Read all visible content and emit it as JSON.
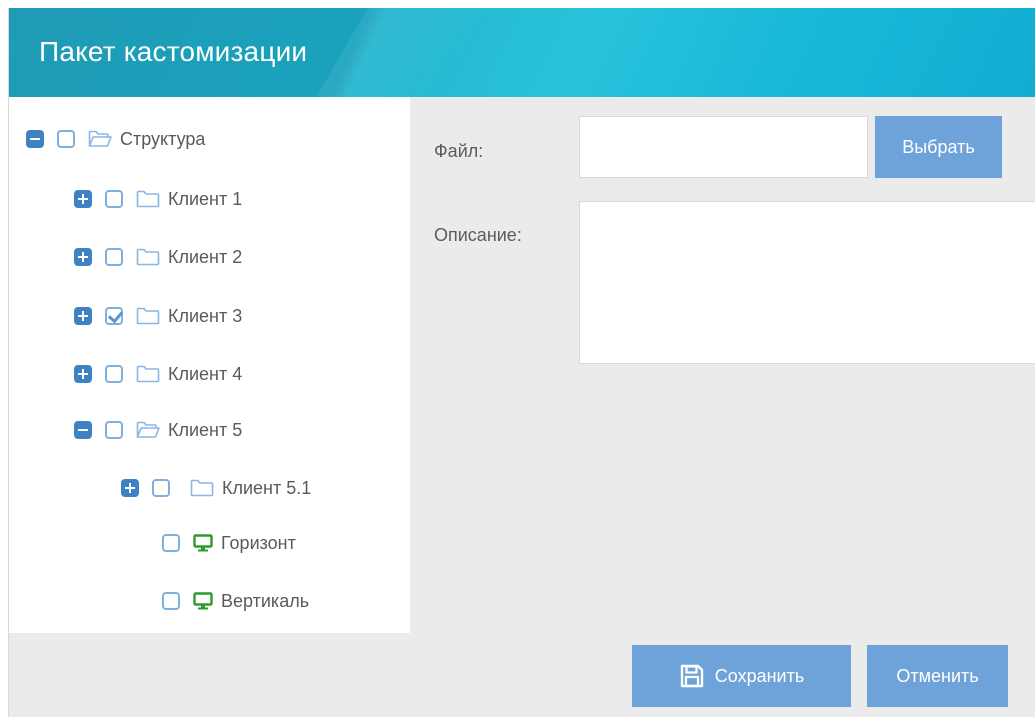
{
  "dialog": {
    "title": "Пакет кастомизации"
  },
  "tree": [
    {
      "label": "Структура",
      "toggle": "minus",
      "checked": false,
      "icon": "folder-open-icon"
    },
    {
      "label": "Клиент 1",
      "toggle": "plus",
      "checked": false,
      "icon": "folder-icon"
    },
    {
      "label": "Клиент 2",
      "toggle": "plus",
      "checked": false,
      "icon": "folder-icon"
    },
    {
      "label": "Клиент 3",
      "toggle": "plus",
      "checked": true,
      "icon": "folder-icon"
    },
    {
      "label": "Клиент 4",
      "toggle": "plus",
      "checked": false,
      "icon": "folder-icon"
    },
    {
      "label": "Клиент 5",
      "toggle": "minus",
      "checked": false,
      "icon": "folder-open-icon"
    },
    {
      "label": "Клиент 5.1",
      "toggle": "plus",
      "checked": false,
      "icon": "folder-icon"
    },
    {
      "label": "Горизонт",
      "toggle": "none",
      "checked": false,
      "icon": "monitor-icon"
    },
    {
      "label": "Вертикаль",
      "toggle": "none",
      "checked": false,
      "icon": "monitor-icon"
    }
  ],
  "form": {
    "file_label": "Файл:",
    "file_value": "",
    "browse_label": "Выбрать",
    "description_label": "Описание:",
    "description_value": ""
  },
  "footer": {
    "save_label": "Сохранить",
    "cancel_label": "Отменить"
  },
  "colors": {
    "header": "#1fa6c2",
    "button": "#6ea3d9",
    "toggle": "#3e82c4",
    "checkbox_border": "#82b0dc",
    "folder": "#8ab6e3",
    "monitor": "#2e9a2e"
  }
}
